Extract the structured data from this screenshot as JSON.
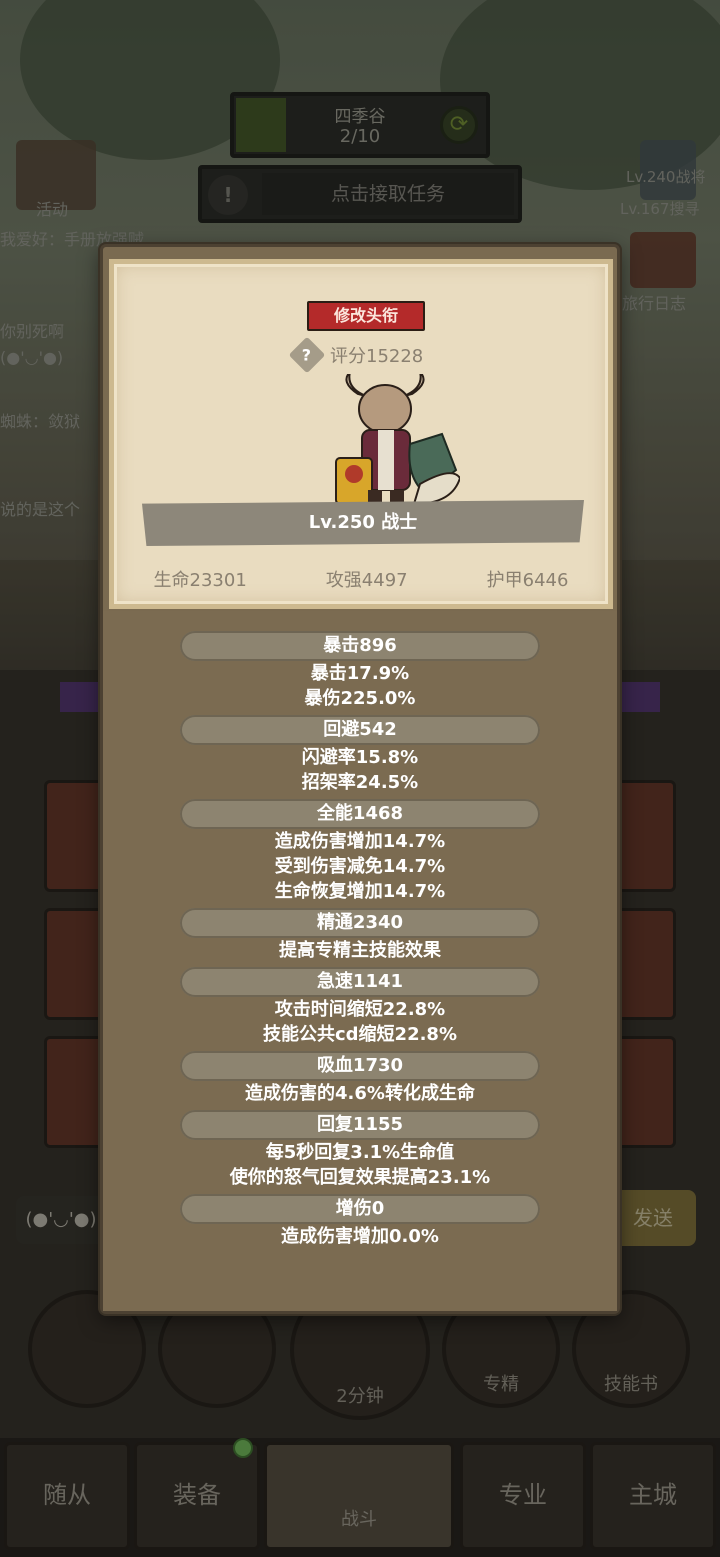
{
  "stage": {
    "name": "四季谷",
    "progress": "2/10"
  },
  "quest": {
    "label": "点击接取任务"
  },
  "side": {
    "activity_label": "活动",
    "chat_lines": [
      "我爱好：手册放强贼",
      "你别死啊",
      "(●'◡'●)",
      "蜘蛛：敛狱",
      "说的是这个"
    ],
    "right_top_lines": [
      "Lv.240战将",
      "Lv.167搜寻"
    ],
    "journal_label": "旅行日志"
  },
  "panel": {
    "title_badge": "修改头衔",
    "score": "评分15228",
    "level_class": "Lv.250 战士",
    "attributes": [
      "生命23301",
      "攻强4497",
      "护甲6446"
    ],
    "stats": [
      {
        "head": "暴击896",
        "lines": [
          "暴击17.9%",
          "暴伤225.0%"
        ]
      },
      {
        "head": "回避542",
        "lines": [
          "闪避率15.8%",
          "招架率24.5%"
        ]
      },
      {
        "head": "全能1468",
        "lines": [
          "造成伤害增加14.7%",
          "受到伤害减免14.7%",
          "生命恢复增加14.7%"
        ]
      },
      {
        "head": "精通2340",
        "lines": [
          "提高专精主技能效果"
        ]
      },
      {
        "head": "急速1141",
        "lines": [
          "攻击时间缩短22.8%",
          "技能公共cd缩短22.8%"
        ]
      },
      {
        "head": "吸血1730",
        "lines": [
          "造成伤害的4.6%转化成生命"
        ]
      },
      {
        "head": "回复1155",
        "lines": [
          "每5秒回复3.1%生命值",
          "使你的怒气回复效果提高23.1%"
        ]
      },
      {
        "head": "增伤0",
        "lines": [
          "造成伤害增加0.0%"
        ]
      }
    ]
  },
  "chat_input": {
    "emote": "(●'◡'●)",
    "send_label": "发送"
  },
  "bottom_circles": [
    "",
    "",
    "2分钟",
    "专精",
    "技能书"
  ],
  "nav": [
    "随从",
    "装备",
    "战斗",
    "专业",
    "主城"
  ],
  "colors": {
    "title_badge": "#b42a2a",
    "panel_parchment": "#e9dcc0",
    "panel_body": "#7b6b51"
  }
}
